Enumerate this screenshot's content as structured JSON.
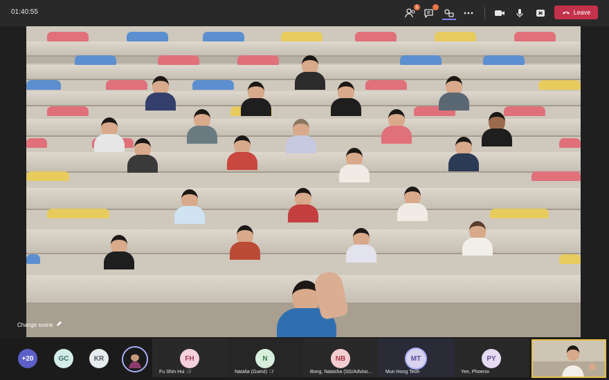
{
  "meeting": {
    "timer": "01:40:55",
    "leave_label": "Leave",
    "badges": {
      "people": "1",
      "chat": ""
    },
    "change_scene_label": "Change scene"
  },
  "toolbar": {
    "icons": [
      "people-icon",
      "chat-icon",
      "apps-icon",
      "more-icon",
      "camera-icon",
      "mic-icon",
      "share-icon",
      "phone-icon"
    ]
  },
  "roster": {
    "overflow_count": "+20",
    "circles": [
      {
        "initials": "GC",
        "bg": "#d3ece8",
        "fg": "#3d6e68"
      },
      {
        "initials": "KR",
        "bg": "#e7ecee",
        "fg": "#4e5b62"
      }
    ],
    "tiles": [
      {
        "initials": "FH",
        "name": "Fu Shin Hui",
        "bg": "#f5d1dc",
        "fg": "#a23c5c"
      },
      {
        "initials": "N",
        "name": "Natalia (Guest)",
        "bg": "#d7eedd",
        "fg": "#3d7a4b"
      },
      {
        "initials": "NB",
        "name": "Bong, Natasha (SG/Adviso...",
        "bg": "#f4cdd0",
        "fg": "#a23a45"
      },
      {
        "initials": "MT",
        "name": "Mun Hong Teoh",
        "bg": "#d9d3ee",
        "fg": "#584c9b"
      },
      {
        "initials": "PY",
        "name": "Yee, Phoenix",
        "bg": "#e5dcf2",
        "fg": "#6a4f98"
      }
    ]
  },
  "colors": {
    "accent": "#7f85f5",
    "leave": "#c4314b",
    "speaking": "#e6c04a"
  }
}
